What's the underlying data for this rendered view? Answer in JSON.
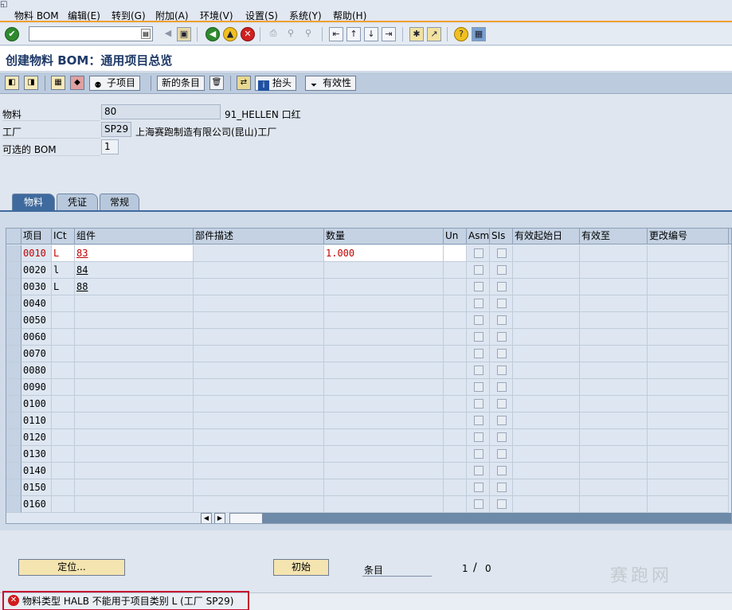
{
  "menu": {
    "items": [
      "物料 BOM",
      "编辑(E)",
      "转到(G)",
      "附加(A)",
      "环境(V)",
      "设置(S)",
      "系统(Y)",
      "帮助(H)"
    ]
  },
  "title": "创建物料 BOM：通用项目总览",
  "app_toolbar": {
    "subitem_label": "子项目",
    "new_entries_label": "新的条目",
    "header_label": "抬头",
    "validity_label": "有效性"
  },
  "header": {
    "material_label": "物料",
    "material_value": "80",
    "material_desc": "91_HELLEN 口红",
    "plant_label": "工厂",
    "plant_value": "SP29",
    "plant_desc": "上海赛跑制造有限公司(昆山)工厂",
    "alt_bom_label": "可选的 BOM",
    "alt_bom_value": "1"
  },
  "tabs": [
    "物料",
    "凭证",
    "常规"
  ],
  "table": {
    "columns": [
      "项目",
      "ICt",
      "组件",
      "部件描述",
      "数量",
      "Un",
      "Asm",
      "SIs",
      "有效起始日",
      "有效至",
      "更改编号"
    ],
    "rows": [
      {
        "item": "0010",
        "ict": "L",
        "component": "83",
        "desc": "",
        "qty": "1.000"
      },
      {
        "item": "0020",
        "ict": "l",
        "component": "84",
        "desc": "",
        "qty": ""
      },
      {
        "item": "0030",
        "ict": "L",
        "component": "88",
        "desc": "",
        "qty": ""
      },
      {
        "item": "0040",
        "ict": "",
        "component": "",
        "desc": "",
        "qty": ""
      },
      {
        "item": "0050",
        "ict": "",
        "component": "",
        "desc": "",
        "qty": ""
      },
      {
        "item": "0060",
        "ict": "",
        "component": "",
        "desc": "",
        "qty": ""
      },
      {
        "item": "0070",
        "ict": "",
        "component": "",
        "desc": "",
        "qty": ""
      },
      {
        "item": "0080",
        "ict": "",
        "component": "",
        "desc": "",
        "qty": ""
      },
      {
        "item": "0090",
        "ict": "",
        "component": "",
        "desc": "",
        "qty": ""
      },
      {
        "item": "0100",
        "ict": "",
        "component": "",
        "desc": "",
        "qty": ""
      },
      {
        "item": "0110",
        "ict": "",
        "component": "",
        "desc": "",
        "qty": ""
      },
      {
        "item": "0120",
        "ict": "",
        "component": "",
        "desc": "",
        "qty": ""
      },
      {
        "item": "0130",
        "ict": "",
        "component": "",
        "desc": "",
        "qty": ""
      },
      {
        "item": "0140",
        "ict": "",
        "component": "",
        "desc": "",
        "qty": ""
      },
      {
        "item": "0150",
        "ict": "",
        "component": "",
        "desc": "",
        "qty": ""
      },
      {
        "item": "0160",
        "ict": "",
        "component": "",
        "desc": "",
        "qty": ""
      }
    ]
  },
  "bottom": {
    "position_label": "定位...",
    "initial_label": "初始",
    "entry_label": "条目",
    "page_current": "1",
    "page_sep": "/",
    "page_total": "0"
  },
  "status": {
    "message": "物料类型 HALB 不能用于项目类别 L (工厂 SP29)",
    "type_icon": "error-icon"
  },
  "watermark": "赛跑网",
  "colors": {
    "accent": "#3f6a9e",
    "error": "#d01c1c",
    "highlight_box": "#c8102e"
  }
}
